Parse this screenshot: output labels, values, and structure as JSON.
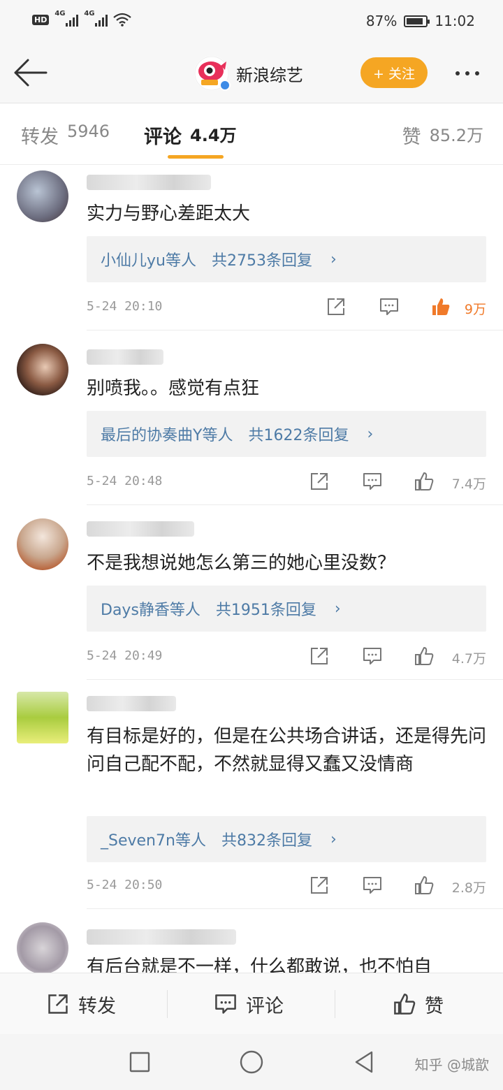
{
  "status_bar": {
    "hd": "HD",
    "net1": "4G",
    "net2": "4G",
    "battery_percent": "87%",
    "battery_level": 0.87,
    "time": "11:02"
  },
  "nav": {
    "account_name": "新浪综艺",
    "follow_label": "+ 关注"
  },
  "tabs": {
    "repost_label": "转发",
    "repost_count": "5946",
    "comment_label": "评论",
    "comment_count": "4.4万",
    "like_label": "赞",
    "like_count": "85.2万"
  },
  "comments": [
    {
      "text": "实力与野心差距太大",
      "reply_user": "小仙儿yu等人",
      "reply_count": "共2753条回复",
      "time": "5-24  20:10",
      "likes": "9万",
      "liked": true
    },
    {
      "text": "别喷我。。感觉有点狂",
      "reply_user": "最后的协奏曲Y等人",
      "reply_count": "共1622条回复",
      "time": "5-24  20:48",
      "likes": "7.4万",
      "liked": false
    },
    {
      "text": "不是我想说她怎么第三的她心里没数？",
      "reply_user": "Days静香等人",
      "reply_count": "共1951条回复",
      "time": "5-24  20:49",
      "likes": "4.7万",
      "liked": false
    },
    {
      "text": "有目标是好的，但是在公共场合讲话，还是得先问问自己配不配，不然就显得又蠢又没情商",
      "reply_user": "_Seven7n等人",
      "reply_count": "共832条回复",
      "time": "5-24  20:50",
      "likes": "2.8万",
      "liked": false
    },
    {
      "text": "有后台就是不一样，什么都敢说，也不怕自"
    }
  ],
  "action_bar": {
    "repost": "转发",
    "comment": "评论",
    "like": "赞"
  },
  "watermark": "知乎 @城歆",
  "colors": {
    "accent": "#f5a623",
    "link": "#4e7ba6",
    "liked": "#f07a2a"
  },
  "icons": [
    "back-arrow-icon",
    "share-icon",
    "comment-icon",
    "thumb-up-icon",
    "square-icon",
    "circle-icon",
    "triangle-back-icon"
  ]
}
